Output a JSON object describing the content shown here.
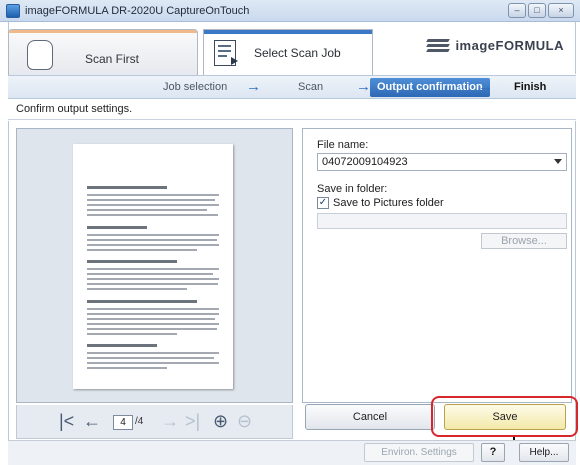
{
  "window": {
    "title": "imageFORMULA DR-2020U CaptureOnTouch",
    "minimize_glyph": "–",
    "maximize_glyph": "□",
    "close_glyph": "×"
  },
  "header": {
    "tab_scan_first": "Scan First",
    "tab_select_scan_job": "Select Scan Job",
    "brand": "imageFORMULA"
  },
  "steps": {
    "job_selection": "Job selection",
    "scan": "Scan",
    "output_confirmation": "Output confirmation",
    "finish": "Finish",
    "arrow_glyph": "→"
  },
  "status": {
    "text": "Confirm output settings."
  },
  "preview": {
    "page_heading_1": "Pellentesque viverra sed nunc velit",
    "page_heading_2": "Aenean commodo varius orci",
    "page_heading_3": "Nullam nec mi quis turpis blandit cursus",
    "page_heading_4": "Duis urna mi, laoreet nec, dignissim vel amet, venenatis sit amet, leo",
    "page_heading_5": "Maecenas accumsan velit in mauris"
  },
  "navigation": {
    "first_glyph": "|<",
    "prev_glyph": "←",
    "current_page": "4",
    "total_pages": "/4",
    "next_glyph": "→",
    "last_glyph": ">|",
    "zoom_in_glyph": "⊕",
    "zoom_out_glyph": "⊖"
  },
  "output": {
    "file_name_label": "File name:",
    "file_name_value": "04072009104923",
    "save_in_folder_label": "Save in folder:",
    "save_to_pictures_label": "Save to Pictures folder",
    "save_to_pictures_checked": true,
    "check_glyph": "✓",
    "folder_path_value": "",
    "browse_label": "Browse..."
  },
  "actions": {
    "cancel_label": "Cancel",
    "save_label": "Save"
  },
  "footer": {
    "env_settings_label": "Environ. Settings",
    "question_label": "?",
    "help_label": "Help..."
  },
  "colors": {
    "accent_blue": "#2d68b4",
    "highlight_red": "#d7262c",
    "save_button": "#f3e9a8"
  }
}
